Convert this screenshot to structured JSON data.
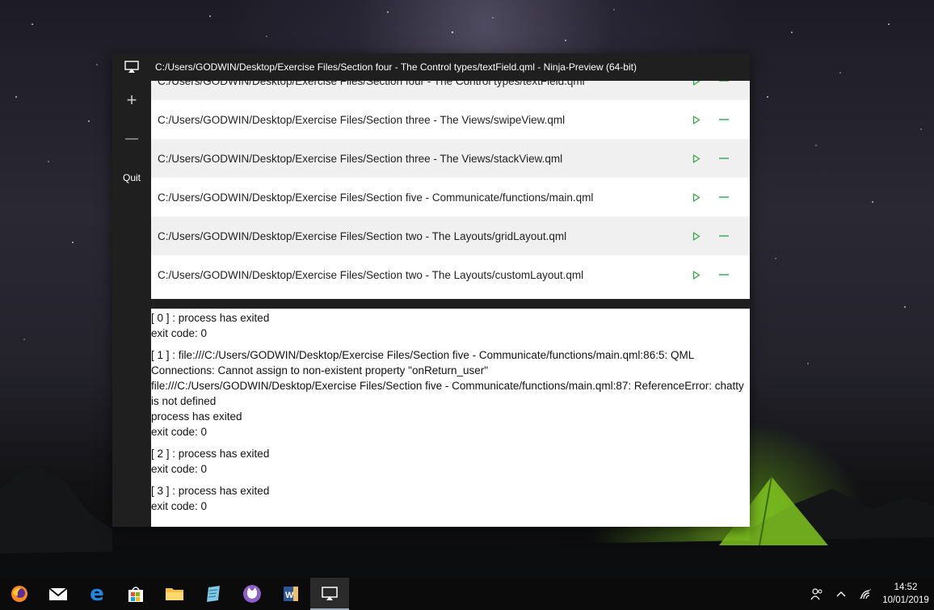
{
  "window": {
    "title": "C:/Users/GODWIN/Desktop/Exercise Files/Section four - The Control types/textField.qml  -  Ninja-Preview  (64-bit)"
  },
  "sidebar": {
    "add_label": "+",
    "remove_label": "—",
    "quit_label": "Quit"
  },
  "files": [
    {
      "path": "C:/Users/GODWIN/Desktop/Exercise Files/Section four - The Control types/textField.qml"
    },
    {
      "path": "C:/Users/GODWIN/Desktop/Exercise Files/Section three - The Views/swipeView.qml"
    },
    {
      "path": "C:/Users/GODWIN/Desktop/Exercise Files/Section three - The Views/stackView.qml"
    },
    {
      "path": "C:/Users/GODWIN/Desktop/Exercise Files/Section five - Communicate/functions/main.qml"
    },
    {
      "path": "C:/Users/GODWIN/Desktop/Exercise Files/Section two - The Layouts/gridLayout.qml"
    },
    {
      "path": "C:/Users/GODWIN/Desktop/Exercise Files/Section two - The Layouts/customLayout.qml"
    }
  ],
  "console": {
    "blocks": [
      {
        "lines": [
          "[ 0 ] : process has exited",
          "exit code: 0"
        ]
      },
      {
        "lines": [
          "[ 1 ] : file:///C:/Users/GODWIN/Desktop/Exercise Files/Section five - Communicate/functions/main.qml:86:5: QML",
          "Connections: Cannot assign to non-existent property \"onReturn_user\"",
          "file:///C:/Users/GODWIN/Desktop/Exercise Files/Section five - Communicate/functions/main.qml:87: ReferenceError: chatty",
          "is not defined",
          "process has exited",
          "exit code: 0"
        ]
      },
      {
        "lines": [
          "[ 2 ] : process has exited",
          "exit code: 0"
        ]
      },
      {
        "lines": [
          "[ 3 ] : process has exited",
          "exit code: 0"
        ]
      }
    ]
  },
  "taskbar": {
    "apps": [
      "firefox-icon",
      "mail-icon",
      "edge-icon",
      "store-icon",
      "file-explorer-icon",
      "notepad-icon",
      "cat-app-icon",
      "word-icon",
      "ninja-preview-icon"
    ],
    "clock": {
      "time": "14:52",
      "date": "10/01/2019"
    }
  },
  "colors": {
    "accent_green": "#2eaa3e",
    "window_bg": "#1f1f1f",
    "row_alt": "#f0f0f0"
  }
}
